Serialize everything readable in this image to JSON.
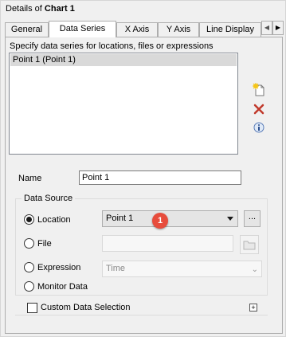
{
  "header": {
    "prefix": "Details of ",
    "chart_name": "Chart 1"
  },
  "tabs": [
    {
      "label": "General"
    },
    {
      "label": "Data Series"
    },
    {
      "label": "X Axis"
    },
    {
      "label": "Y Axis"
    },
    {
      "label": "Line Display"
    }
  ],
  "active_tab": "Data Series",
  "series_panel": {
    "hint": "Specify data series for locations, files or expressions",
    "items": [
      {
        "label": "Point 1 (Point 1)"
      }
    ]
  },
  "side_icons": [
    "new-series-icon",
    "delete-icon",
    "info-icon"
  ],
  "name_field": {
    "label": "Name",
    "value": "Point 1"
  },
  "data_source": {
    "title": "Data Source",
    "options": [
      {
        "label": "Location",
        "selected": true
      },
      {
        "label": "File",
        "selected": false
      },
      {
        "label": "Expression",
        "selected": false
      },
      {
        "label": "Monitor Data",
        "selected": false
      }
    ],
    "location_value": "Point 1",
    "browse_label": "...",
    "expression_value": "Time"
  },
  "annotation_badge": "1",
  "custom_selection": {
    "label": "Custom Data Selection",
    "checked": false,
    "expander": "+"
  },
  "colors": {
    "badge": "#e74c3c",
    "delete_icon": "#c0392b",
    "selection": "#d9d9d9"
  }
}
